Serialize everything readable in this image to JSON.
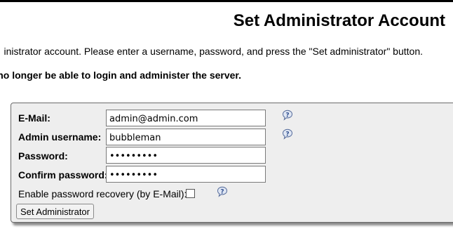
{
  "page": {
    "title": "Set Administrator Account",
    "intro": "inistrator account. Please enter a username, password, and press the \"Set administrator\" button.",
    "warning": "no longer be able to login and administer the server."
  },
  "form": {
    "email_label": "E-Mail:",
    "email_value": "admin@admin.com",
    "username_label": "Admin username:",
    "username_value": "bubbleman",
    "password_label": "Password:",
    "password_value": "bubbleman",
    "confirm_label": "Confirm password:",
    "confirm_value": "bubbleman",
    "recovery_label": "Enable password recovery (by E-Mail):",
    "recovery_checked": false,
    "submit_label": "Set Administrator"
  },
  "icons": {
    "help": "help-question-icon"
  },
  "colors": {
    "panel_bg": "#eeeeee",
    "help_icon_fill": "#dfe6f3",
    "help_icon_stroke": "#556b9a"
  }
}
